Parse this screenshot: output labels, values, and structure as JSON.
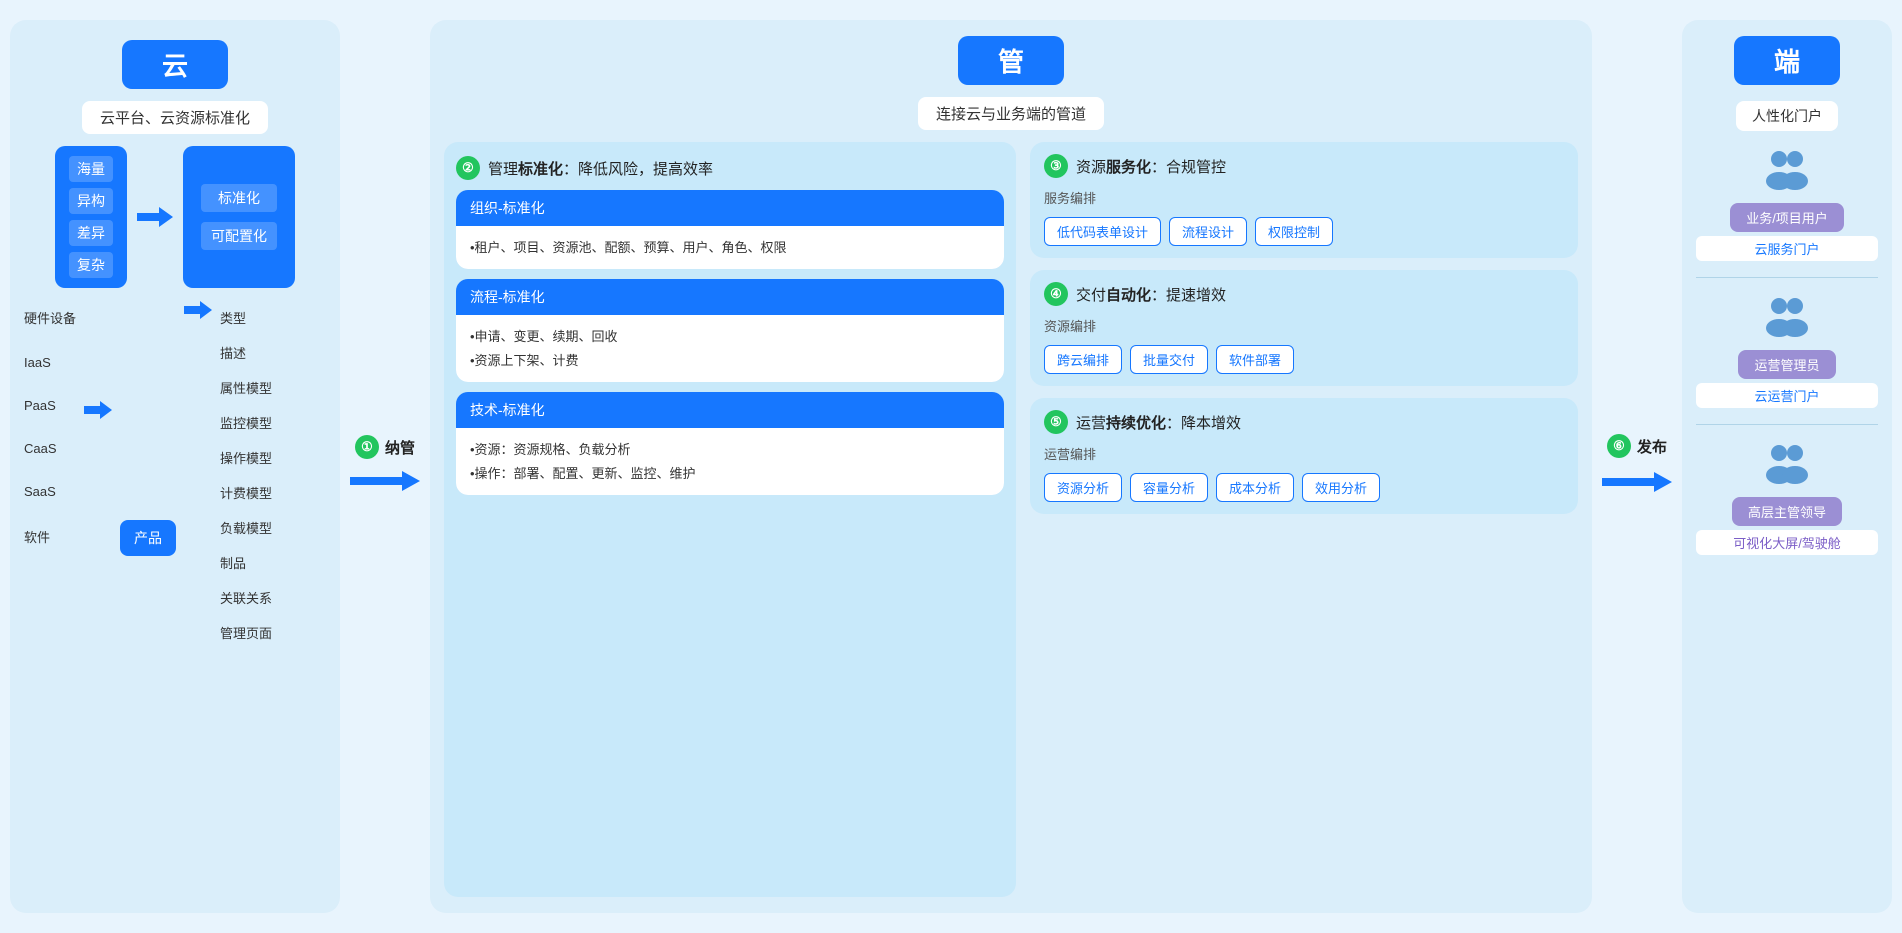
{
  "cloud": {
    "title": "云",
    "subtitle": "云平台、云资源标准化",
    "left_items": [
      "海量",
      "异构",
      "差异",
      "复杂"
    ],
    "right_items": [
      "标准化",
      "可配置化"
    ],
    "hardware_list": [
      "硬件设备",
      "IaaS",
      "PaaS",
      "CaaS",
      "SaaS",
      "软件"
    ],
    "product_label": "产品",
    "model_list": [
      "类型",
      "描述",
      "属性模型",
      "监控模型",
      "操作模型",
      "计费模型",
      "负载模型",
      "制品",
      "关联关系",
      "管理页面"
    ]
  },
  "arrow1": {
    "num": "①",
    "label": "纳管"
  },
  "manage": {
    "title": "管",
    "subtitle": "连接云与业务端的管道",
    "left": {
      "header_num": "②",
      "header_text": "管理",
      "header_bold": "标准化",
      "header_suffix": "：降低风险，提高效率",
      "cards": [
        {
          "id": "org",
          "header": "组织-标准化",
          "body": "•租户、项目、资源池、配额、预算、用户、角色、权限"
        },
        {
          "id": "flow",
          "header": "流程-标准化",
          "body": "•申请、变更、续期、回收\n•资源上下架、计费"
        },
        {
          "id": "tech",
          "header": "技术-标准化",
          "body": "•资源：资源规格、负载分析\n•操作：部署、配置、更新、监控、维护"
        }
      ]
    },
    "right": [
      {
        "num": "③",
        "title_prefix": "资源",
        "title_bold": "服务化",
        "title_suffix": "：合规管控",
        "sub_label": "服务编排",
        "tags": [
          "低代码表单设计",
          "流程设计",
          "权限控制"
        ]
      },
      {
        "num": "④",
        "title_prefix": "交付",
        "title_bold": "自动化",
        "title_suffix": "：提速增效",
        "sub_label": "资源编排",
        "tags": [
          "跨云编排",
          "批量交付",
          "软件部署"
        ]
      },
      {
        "num": "⑤",
        "title_prefix": "运营",
        "title_bold": "持续优化",
        "title_suffix": "：降本增效",
        "sub_label": "运营编排",
        "tags": [
          "资源分析",
          "容量分析",
          "成本分析",
          "效用分析"
        ]
      }
    ]
  },
  "arrow2": {
    "num": "⑥",
    "label": "发布"
  },
  "end": {
    "title": "端",
    "subtitle": "人性化门户",
    "users": [
      {
        "id": "business",
        "icon": "👥",
        "label": "业务/项目用户",
        "sublabel": "云服务门户"
      },
      {
        "id": "ops",
        "icon": "👥",
        "label": "运营管理员",
        "sublabel": "云运营门户"
      },
      {
        "id": "leader",
        "icon": "👥",
        "label": "高层主管领导",
        "sublabel": "可视化大屏/驾驶舱"
      }
    ]
  }
}
